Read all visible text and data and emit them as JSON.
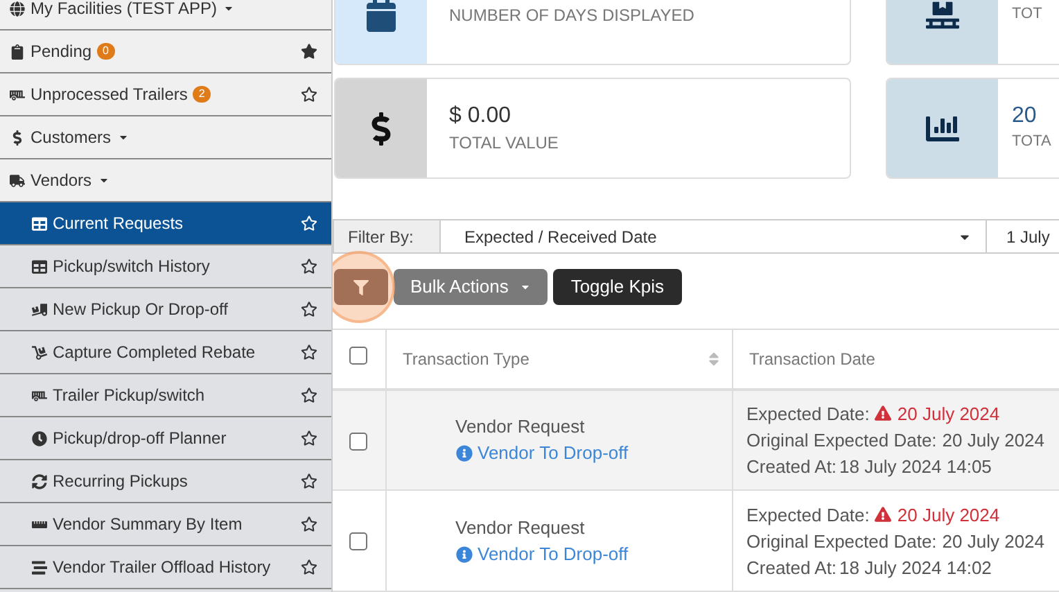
{
  "sidebar": {
    "items": [
      {
        "label": "My Facilities (TEST APP)",
        "kind": "group",
        "dropdown": true,
        "selected": false
      },
      {
        "label": "Pending",
        "kind": "group",
        "badge": "0",
        "dropdown": false,
        "starred": true,
        "selected": false
      },
      {
        "label": "Unprocessed Trailers",
        "kind": "group",
        "badge": "2",
        "dropdown": false,
        "starred": false,
        "selected": false
      },
      {
        "label": "Customers",
        "kind": "group",
        "dropdown": true,
        "selected": false
      },
      {
        "label": "Vendors",
        "kind": "group",
        "dropdown": true,
        "selected": false
      },
      {
        "label": "Current Requests",
        "kind": "subitem",
        "dropdown": false,
        "starred": false,
        "selected": true
      },
      {
        "label": "Pickup/switch History",
        "kind": "subitem",
        "dropdown": false,
        "starred": false,
        "selected": false
      },
      {
        "label": "New Pickup Or Drop-off",
        "kind": "subitem",
        "dropdown": false,
        "starred": false,
        "selected": false
      },
      {
        "label": "Capture Completed Rebate",
        "kind": "subitem",
        "dropdown": false,
        "starred": false,
        "selected": false
      },
      {
        "label": "Trailer Pickup/switch",
        "kind": "subitem",
        "dropdown": false,
        "starred": false,
        "selected": false
      },
      {
        "label": "Pickup/drop-off Planner",
        "kind": "subitem",
        "dropdown": false,
        "starred": false,
        "selected": false
      },
      {
        "label": "Recurring Pickups",
        "kind": "subitem",
        "dropdown": false,
        "starred": false,
        "selected": false
      },
      {
        "label": "Vendor Summary By Item",
        "kind": "subitem",
        "dropdown": false,
        "starred": false,
        "selected": false
      },
      {
        "label": "Vendor Trailer Offload History",
        "kind": "subitem",
        "dropdown": false,
        "starred": false,
        "selected": false
      }
    ]
  },
  "kpis": [
    {
      "label": "NUMBER OF DAYS DISPLAYED",
      "color": "#d6e9fa"
    },
    {
      "label": "TOT",
      "color": "#cddde8"
    },
    {
      "value": "$ 0.00",
      "label": "TOTAL VALUE",
      "color": "#d4d4d4"
    },
    {
      "value": "20",
      "label": "TOTA",
      "color": "#cddde8"
    }
  ],
  "filter": {
    "label": "Filter By:",
    "value": "Expected / Received Date",
    "date": "1 July"
  },
  "toolbar": {
    "bulk_actions": "Bulk Actions",
    "toggle_kpis": "Toggle Kpis"
  },
  "table": {
    "all_checked": false,
    "columns": [
      {
        "label": "Transaction Type",
        "sortable": true
      },
      {
        "label": "Transaction Date"
      }
    ],
    "rows": [
      {
        "checked": false,
        "type": "Vendor Request",
        "subtype": "Vendor To Drop-off",
        "expected_label": "Expected Date:",
        "expected": "20 July 2024",
        "overdue": true,
        "original_label": "Original Expected Date:",
        "original": "20 July 2024",
        "created_label": "Created At:",
        "created": "18 July 2024 14:05"
      },
      {
        "checked": false,
        "type": "Vendor Request",
        "subtype": "Vendor To Drop-off",
        "expected_label": "Expected Date:",
        "expected": "20 July 2024",
        "overdue": true,
        "original_label": "Original Expected Date:",
        "original": "20 July 2024",
        "created_label": "Created At:",
        "created": "18 July 2024 14:02"
      }
    ]
  }
}
